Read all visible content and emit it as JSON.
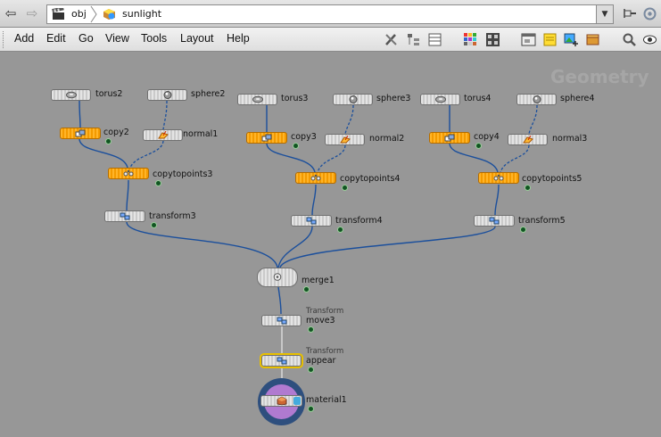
{
  "pathbar": {
    "back_icon": "back-arrow-icon",
    "forward_icon": "forward-arrow-icon",
    "crumbs": [
      {
        "label": "obj",
        "icon": "clapper-icon"
      },
      {
        "label": "sunlight",
        "icon": "geometry-object-icon"
      }
    ]
  },
  "menubar": {
    "items": [
      "Add",
      "Edit",
      "Go",
      "View",
      "Tools",
      "Layout",
      "Help"
    ]
  },
  "network": {
    "context_label": "Geometry",
    "nodes": [
      {
        "name": "torus2",
        "type": "",
        "icon": "torus-icon",
        "style": "gray"
      },
      {
        "name": "sphere2",
        "type": "",
        "icon": "sphere-icon",
        "style": "gray"
      },
      {
        "name": "copy2",
        "type": "",
        "icon": "copy-icon",
        "style": "orange"
      },
      {
        "name": "normal1",
        "type": "",
        "icon": "normal-icon",
        "style": "gray"
      },
      {
        "name": "copytopoints3",
        "type": "",
        "icon": "copytopoints-icon",
        "style": "orange"
      },
      {
        "name": "transform3",
        "type": "",
        "icon": "transform-icon",
        "style": "gray"
      },
      {
        "name": "torus3",
        "type": "",
        "icon": "torus-icon",
        "style": "gray"
      },
      {
        "name": "sphere3",
        "type": "",
        "icon": "sphere-icon",
        "style": "gray"
      },
      {
        "name": "copy3",
        "type": "",
        "icon": "copy-icon",
        "style": "orange"
      },
      {
        "name": "normal2",
        "type": "",
        "icon": "normal-icon",
        "style": "gray"
      },
      {
        "name": "copytopoints4",
        "type": "",
        "icon": "copytopoints-icon",
        "style": "orange"
      },
      {
        "name": "transform4",
        "type": "",
        "icon": "transform-icon",
        "style": "gray"
      },
      {
        "name": "torus4",
        "type": "",
        "icon": "torus-icon",
        "style": "gray"
      },
      {
        "name": "sphere4",
        "type": "",
        "icon": "sphere-icon",
        "style": "gray"
      },
      {
        "name": "copy4",
        "type": "",
        "icon": "copy-icon",
        "style": "orange"
      },
      {
        "name": "normal3",
        "type": "",
        "icon": "normal-icon",
        "style": "gray"
      },
      {
        "name": "copytopoints5",
        "type": "",
        "icon": "copytopoints-icon",
        "style": "orange"
      },
      {
        "name": "transform5",
        "type": "",
        "icon": "transform-icon",
        "style": "gray"
      },
      {
        "name": "merge1",
        "type": "",
        "icon": "merge-icon",
        "style": "gray"
      },
      {
        "name": "move3",
        "type": "Transform",
        "icon": "transform-icon",
        "style": "gray"
      },
      {
        "name": "appear",
        "type": "Transform",
        "icon": "transform-icon",
        "style": "gray"
      },
      {
        "name": "material1",
        "type": "",
        "icon": "material-icon",
        "style": "gray"
      }
    ]
  }
}
